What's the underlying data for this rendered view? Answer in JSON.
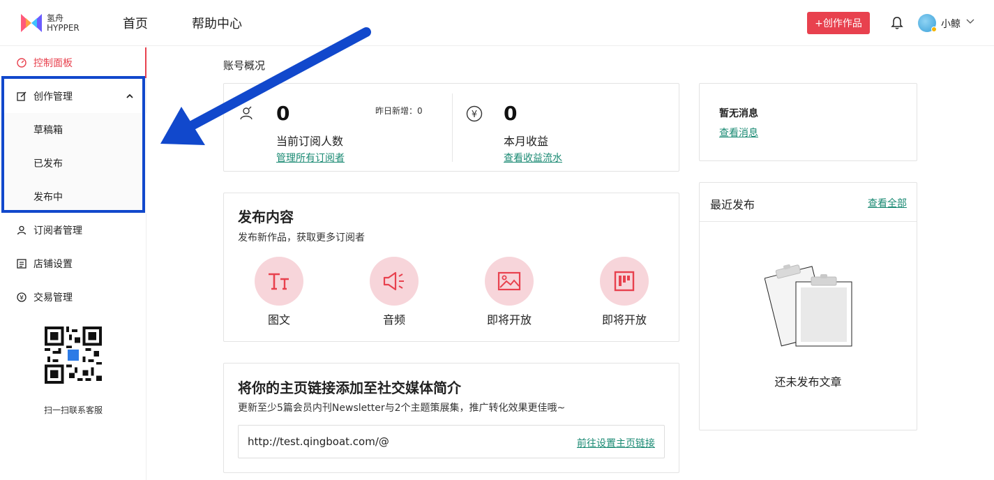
{
  "brand": {
    "line1": "氢舟",
    "line2": "HYPPER"
  },
  "nav": {
    "home": "首页",
    "help": "帮助中心"
  },
  "header": {
    "create_button": "+创作作品",
    "username": "小鲸"
  },
  "sidebar": {
    "items": [
      {
        "label": "控制面板",
        "icon": "dashboard-icon",
        "active": true
      },
      {
        "label": "创作管理",
        "icon": "edit-icon",
        "expanded": true
      },
      {
        "label": "草稿箱"
      },
      {
        "label": "已发布"
      },
      {
        "label": "发布中"
      },
      {
        "label": "订阅者管理",
        "icon": "user-icon"
      },
      {
        "label": "店铺设置",
        "icon": "list-icon"
      },
      {
        "label": "交易管理",
        "icon": "yen-icon"
      }
    ],
    "qr_label": "扫一扫联系客服"
  },
  "overview": {
    "title": "账号概况",
    "subscribers": {
      "count": "0",
      "label": "当前订阅人数",
      "yesterday": "昨日新增：0",
      "link": "管理所有订阅者"
    },
    "income": {
      "count": "0",
      "label": "本月收益",
      "link": "查看收益流水"
    }
  },
  "publish": {
    "title": "发布内容",
    "subtitle": "发布新作品，获取更多订阅者",
    "options": [
      {
        "label": "图文",
        "icon": "text-type-icon"
      },
      {
        "label": "音频",
        "icon": "megaphone-icon"
      },
      {
        "label": "即将开放",
        "icon": "image-icon"
      },
      {
        "label": "即将开放",
        "icon": "board-icon"
      }
    ]
  },
  "social": {
    "title": "将你的主页链接添加至社交媒体简介",
    "subtitle": "更新至少5篇会员内刊Newsletter与2个主题策展集，推广转化效果更佳哦~",
    "url": "http://test.qingboat.com/@",
    "link": "前往设置主页链接"
  },
  "messages": {
    "title": "暂无消息",
    "link": "查看消息"
  },
  "recent": {
    "title": "最近发布",
    "link": "查看全部",
    "empty": "还未发布文章"
  },
  "colors": {
    "accent": "#e8414e",
    "link": "#1a8a73",
    "highlight": "#1148cc"
  }
}
